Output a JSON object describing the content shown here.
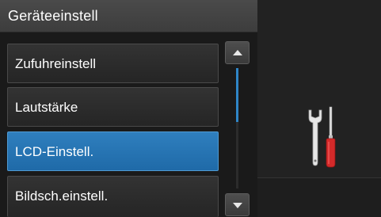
{
  "header": {
    "title": "Geräteeinstell"
  },
  "menu": {
    "items": [
      {
        "label": "Zufuhreinstell",
        "selected": false
      },
      {
        "label": "Lautstärke",
        "selected": false
      },
      {
        "label": "LCD-Einstell.",
        "selected": true
      },
      {
        "label": "Bildsch.einstell.",
        "selected": false
      }
    ]
  },
  "scrollbar": {
    "up_icon": "arrow-up-icon",
    "down_icon": "arrow-down-icon",
    "position_fraction": 0.0
  },
  "side_icon": "tools-icon",
  "colors": {
    "selected": "#2a78b8",
    "scroll_thumb": "#2f86c8",
    "screwdriver_handle": "#d42a2a"
  }
}
